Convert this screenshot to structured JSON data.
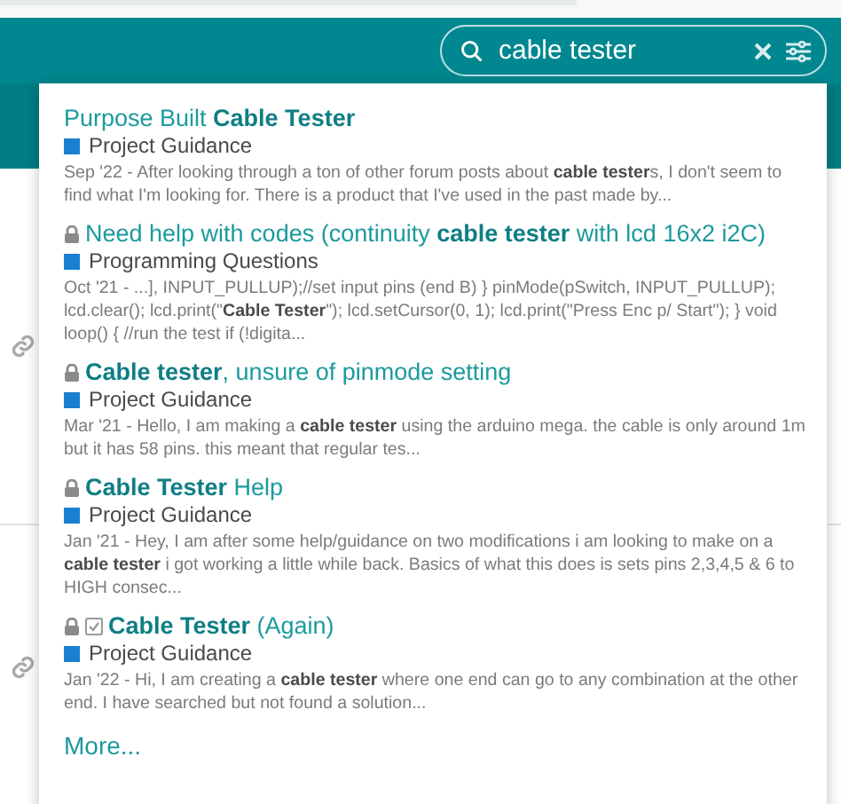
{
  "search": {
    "value": "cable tester"
  },
  "results": [
    {
      "title": "Purpose Built **Cable Tester**",
      "locked": false,
      "solved": false,
      "category": {
        "name": "Project Guidance",
        "color": "#1a7fd0"
      },
      "excerpt": "Sep '22 - After looking through a ton of other forum posts about **cable tester**s, I don't seem to find what I'm looking for. There is a product that I've used in the past made by..."
    },
    {
      "title": "Need help with codes (continuity **cable tester** with lcd 16x2 i2C)",
      "locked": true,
      "solved": false,
      "category": {
        "name": "Programming Questions",
        "color": "#1a7fd0"
      },
      "excerpt": "Oct '21 - ...], INPUT_PULLUP);//set input pins (end B) } pinMode(pSwitch, INPUT_PULLUP); lcd.clear(); lcd.print(\"**Cable Tester**\"); lcd.setCursor(0, 1); lcd.print(\"Press Enc p/ Start\"); } void loop() { //run the test if (!digita..."
    },
    {
      "title": "**Cable tester**, unsure of pinmode setting",
      "locked": true,
      "solved": false,
      "category": {
        "name": "Project Guidance",
        "color": "#1a7fd0"
      },
      "excerpt": "Mar '21 - Hello, I am making a **cable tester** using the arduino mega. the cable is only around 1m but it has 58 pins. this meant that regular tes..."
    },
    {
      "title": "**Cable Tester** Help",
      "locked": true,
      "solved": false,
      "category": {
        "name": "Project Guidance",
        "color": "#1a7fd0"
      },
      "excerpt": "Jan '21 - Hey, I am after some help/guidance on two modifications i am looking to make on a **cable tester** i got working a little while back. Basics of what this does is sets pins 2,3,4,5 & 6 to HIGH consec..."
    },
    {
      "title": "**Cable Tester** (Again)",
      "locked": true,
      "solved": true,
      "category": {
        "name": "Project Guidance",
        "color": "#1a7fd0"
      },
      "excerpt": "Jan '22 - Hi, I am creating a **cable tester** where one end can go to any combination at the other end. I have searched but not found a solution..."
    }
  ],
  "more_link": "More..."
}
